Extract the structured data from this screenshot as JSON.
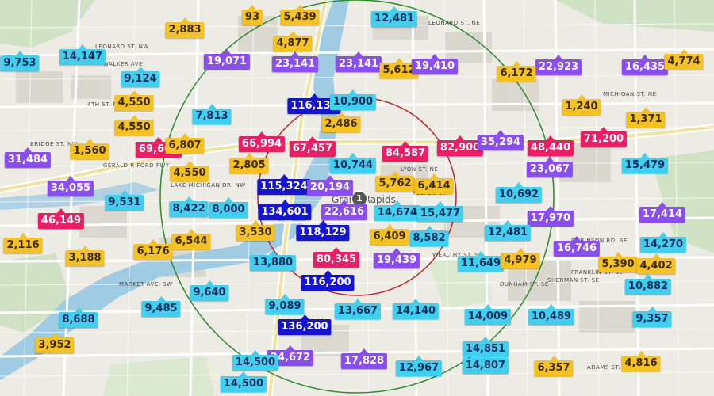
{
  "city_label": "Grand Rapids",
  "center_marker": "1",
  "colors": {
    "cyan": "#3fd0f0",
    "yellow": "#f5c221",
    "purple": "#8a4ef0",
    "pink": "#ee1c64",
    "blue": "#1414d2",
    "inner_ring": "#c0262b",
    "outer_ring": "#2e8b2e"
  },
  "streets": [
    "LEONARD ST. NE",
    "LEONARD ST. NW",
    "WALKER AVE",
    "4TH ST. NW",
    "BRIDGE ST. NW",
    "LAKE MICHIGAN DR. NW",
    "FULTON ST.",
    "WEALTHY ST. SE",
    "MARKET AVE. SW",
    "ROBINSON RD. SE",
    "FRANKLIN ST. SE",
    "ADAMS ST. SE",
    "GERALD R FORD FWY",
    "MICHIGAN ST. NE",
    "LYON ST. NE",
    "DUNHAM ST. SE",
    "SHERMAN ST. SE"
  ],
  "badges": [
    {
      "label": "93",
      "color": "yellow"
    },
    {
      "label": "5,439",
      "color": "yellow"
    },
    {
      "label": "12,481",
      "color": "cyan"
    },
    {
      "label": "2,883",
      "color": "yellow"
    },
    {
      "label": "4,877",
      "color": "yellow"
    },
    {
      "label": "9,753",
      "color": "cyan"
    },
    {
      "label": "14,147",
      "color": "cyan"
    },
    {
      "label": "19,071",
      "color": "purple"
    },
    {
      "label": "23,141",
      "color": "purple"
    },
    {
      "label": "23,141",
      "color": "purple"
    },
    {
      "label": "5,612",
      "color": "yellow"
    },
    {
      "label": "19,410",
      "color": "purple"
    },
    {
      "label": "22,923",
      "color": "purple"
    },
    {
      "label": "16,435",
      "color": "purple"
    },
    {
      "label": "4,774",
      "color": "yellow"
    },
    {
      "label": "9,124",
      "color": "cyan"
    },
    {
      "label": "6,172",
      "color": "yellow"
    },
    {
      "label": "4,550",
      "color": "yellow"
    },
    {
      "label": "116,135",
      "color": "blue"
    },
    {
      "label": "10,900",
      "color": "cyan"
    },
    {
      "label": "1,240",
      "color": "yellow"
    },
    {
      "label": "7,813",
      "color": "cyan"
    },
    {
      "label": "4,550",
      "color": "yellow"
    },
    {
      "label": "2,486",
      "color": "yellow"
    },
    {
      "label": "1,371",
      "color": "yellow"
    },
    {
      "label": "1,560",
      "color": "yellow"
    },
    {
      "label": "69,601",
      "color": "pink"
    },
    {
      "label": "6,807",
      "color": "yellow"
    },
    {
      "label": "66,994",
      "color": "pink"
    },
    {
      "label": "67,457",
      "color": "pink"
    },
    {
      "label": "84,587",
      "color": "pink"
    },
    {
      "label": "82,900",
      "color": "pink"
    },
    {
      "label": "35,294",
      "color": "purple"
    },
    {
      "label": "48,440",
      "color": "pink"
    },
    {
      "label": "71,200",
      "color": "pink"
    },
    {
      "label": "31,484",
      "color": "purple"
    },
    {
      "label": "2,805",
      "color": "yellow"
    },
    {
      "label": "10,744",
      "color": "cyan"
    },
    {
      "label": "23,067",
      "color": "purple"
    },
    {
      "label": "15,479",
      "color": "cyan"
    },
    {
      "label": "4,550",
      "color": "yellow"
    },
    {
      "label": "34,055",
      "color": "purple"
    },
    {
      "label": "115,324",
      "color": "blue"
    },
    {
      "label": "20,194",
      "color": "purple"
    },
    {
      "label": "5,762",
      "color": "yellow"
    },
    {
      "label": "6,414",
      "color": "yellow"
    },
    {
      "label": "9,531",
      "color": "cyan"
    },
    {
      "label": "10,692",
      "color": "cyan"
    },
    {
      "label": "8,422",
      "color": "cyan"
    },
    {
      "label": "8,000",
      "color": "cyan"
    },
    {
      "label": "134,601",
      "color": "blue"
    },
    {
      "label": "22,616",
      "color": "purple"
    },
    {
      "label": "14,674",
      "color": "cyan"
    },
    {
      "label": "15,477",
      "color": "cyan"
    },
    {
      "label": "17,970",
      "color": "purple"
    },
    {
      "label": "17,414",
      "color": "purple"
    },
    {
      "label": "46,149",
      "color": "pink"
    },
    {
      "label": "3,530",
      "color": "yellow"
    },
    {
      "label": "118,129",
      "color": "blue"
    },
    {
      "label": "6,409",
      "color": "yellow"
    },
    {
      "label": "8,582",
      "color": "cyan"
    },
    {
      "label": "12,481",
      "color": "cyan"
    },
    {
      "label": "2,116",
      "color": "yellow"
    },
    {
      "label": "6,544",
      "color": "yellow"
    },
    {
      "label": "16,746",
      "color": "purple"
    },
    {
      "label": "14,270",
      "color": "cyan"
    },
    {
      "label": "6,176",
      "color": "yellow"
    },
    {
      "label": "3,188",
      "color": "yellow"
    },
    {
      "label": "80,345",
      "color": "pink"
    },
    {
      "label": "19,439",
      "color": "purple"
    },
    {
      "label": "11,649",
      "color": "cyan"
    },
    {
      "label": "4,979",
      "color": "yellow"
    },
    {
      "label": "5,390",
      "color": "yellow"
    },
    {
      "label": "4,402",
      "color": "yellow"
    },
    {
      "label": "13,880",
      "color": "cyan"
    },
    {
      "label": "116,200",
      "color": "blue"
    },
    {
      "label": "10,882",
      "color": "cyan"
    },
    {
      "label": "9,640",
      "color": "cyan"
    },
    {
      "label": "9,089",
      "color": "cyan"
    },
    {
      "label": "9,485",
      "color": "cyan"
    },
    {
      "label": "13,667",
      "color": "cyan"
    },
    {
      "label": "14,140",
      "color": "cyan"
    },
    {
      "label": "14,009",
      "color": "cyan"
    },
    {
      "label": "10,489",
      "color": "cyan"
    },
    {
      "label": "9,357",
      "color": "cyan"
    },
    {
      "label": "8,688",
      "color": "cyan"
    },
    {
      "label": "136,200",
      "color": "blue"
    },
    {
      "label": "3,952",
      "color": "yellow"
    },
    {
      "label": "14,851",
      "color": "cyan"
    },
    {
      "label": "24,672",
      "color": "purple"
    },
    {
      "label": "17,828",
      "color": "purple"
    },
    {
      "label": "14,500",
      "color": "cyan"
    },
    {
      "label": "12,967",
      "color": "cyan"
    },
    {
      "label": "14,807",
      "color": "cyan"
    },
    {
      "label": "6,357",
      "color": "yellow"
    },
    {
      "label": "4,816",
      "color": "yellow"
    },
    {
      "label": "14,500",
      "color": "cyan"
    }
  ]
}
